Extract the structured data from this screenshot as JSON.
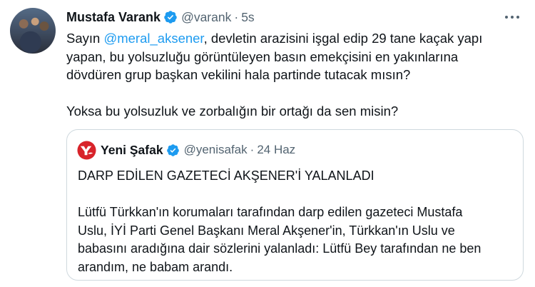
{
  "tweet": {
    "display_name": "Mustafa Varank",
    "handle": "@varank",
    "separator": "·",
    "time": "5s",
    "body_lines": [
      {
        "pre": "Sayın ",
        "mention": "@meral_aksener",
        "post": ", devletin arazisini işgal edip 29 tane kaçak yapı"
      },
      "yapan, bu yolsuzluğu görüntüleyen basın emekçisini en yakınlarına",
      "dövdüren grup başkan vekilini hala partinde tutacak mısın?",
      "Yoksa bu yolsuzluk ve zorbalığın bir ortağı da sen misin?"
    ],
    "accent_color": "#1d9bf0",
    "text_color": "#0f1419",
    "muted_color": "#536471"
  },
  "quote": {
    "display_name": "Yeni Şafak",
    "handle": "@yenisafak",
    "separator": "·",
    "date": "24 Haz",
    "logo_color": "#d8232a",
    "headline": "DARP EDİLEN GAZETECİ AKŞENER'İ YALANLADI",
    "body_lines": [
      "Lütfü Türkkan'ın korumaları tarafından darp edilen gazeteci Mustafa",
      "Uslu, İYİ Parti Genel Başkanı Meral Akşener'in, Türkkan'ın Uslu ve",
      "babasını aradığına dair sözlerini yalanladı: Lütfü Bey tarafından ne ben",
      "arandım, ne babam arandı."
    ]
  },
  "icons": {
    "verified": "verified-badge-icon",
    "more": "more-horizontal-icon"
  }
}
